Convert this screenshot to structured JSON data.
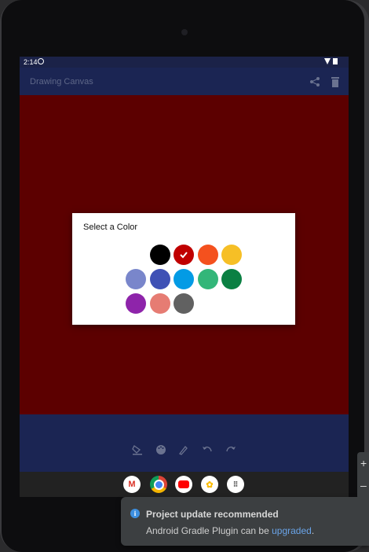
{
  "status": {
    "time": "2:14"
  },
  "appbar": {
    "title": "Drawing Canvas",
    "share_icon": "share-icon",
    "delete_icon": "trash-icon"
  },
  "canvas": {
    "background": "#5c0000"
  },
  "dialog": {
    "title": "Select a Color",
    "selected": "#c00000",
    "colors": [
      "#000000",
      "#c00000",
      "#f4511e",
      "#f6bf26",
      "#7986cb",
      "#3f51b5",
      "#039be5",
      "#33b679",
      "#0b8043",
      "#8e24aa",
      "#e67c73",
      "#616161"
    ]
  },
  "toolbar": {
    "tools": [
      "fill-icon",
      "palette-icon",
      "brush-icon",
      "undo-icon",
      "redo-icon"
    ]
  },
  "dock": {
    "apps": [
      "gmail-icon",
      "chrome-icon",
      "youtube-icon",
      "photos-icon",
      "apps-grid-icon"
    ]
  },
  "notification": {
    "title": "Project update recommended",
    "body_prefix": "Android Gradle Plugin can be ",
    "link": "upgraded",
    "body_suffix": "."
  },
  "side_panel": {
    "plus": "+",
    "minus": "–"
  }
}
